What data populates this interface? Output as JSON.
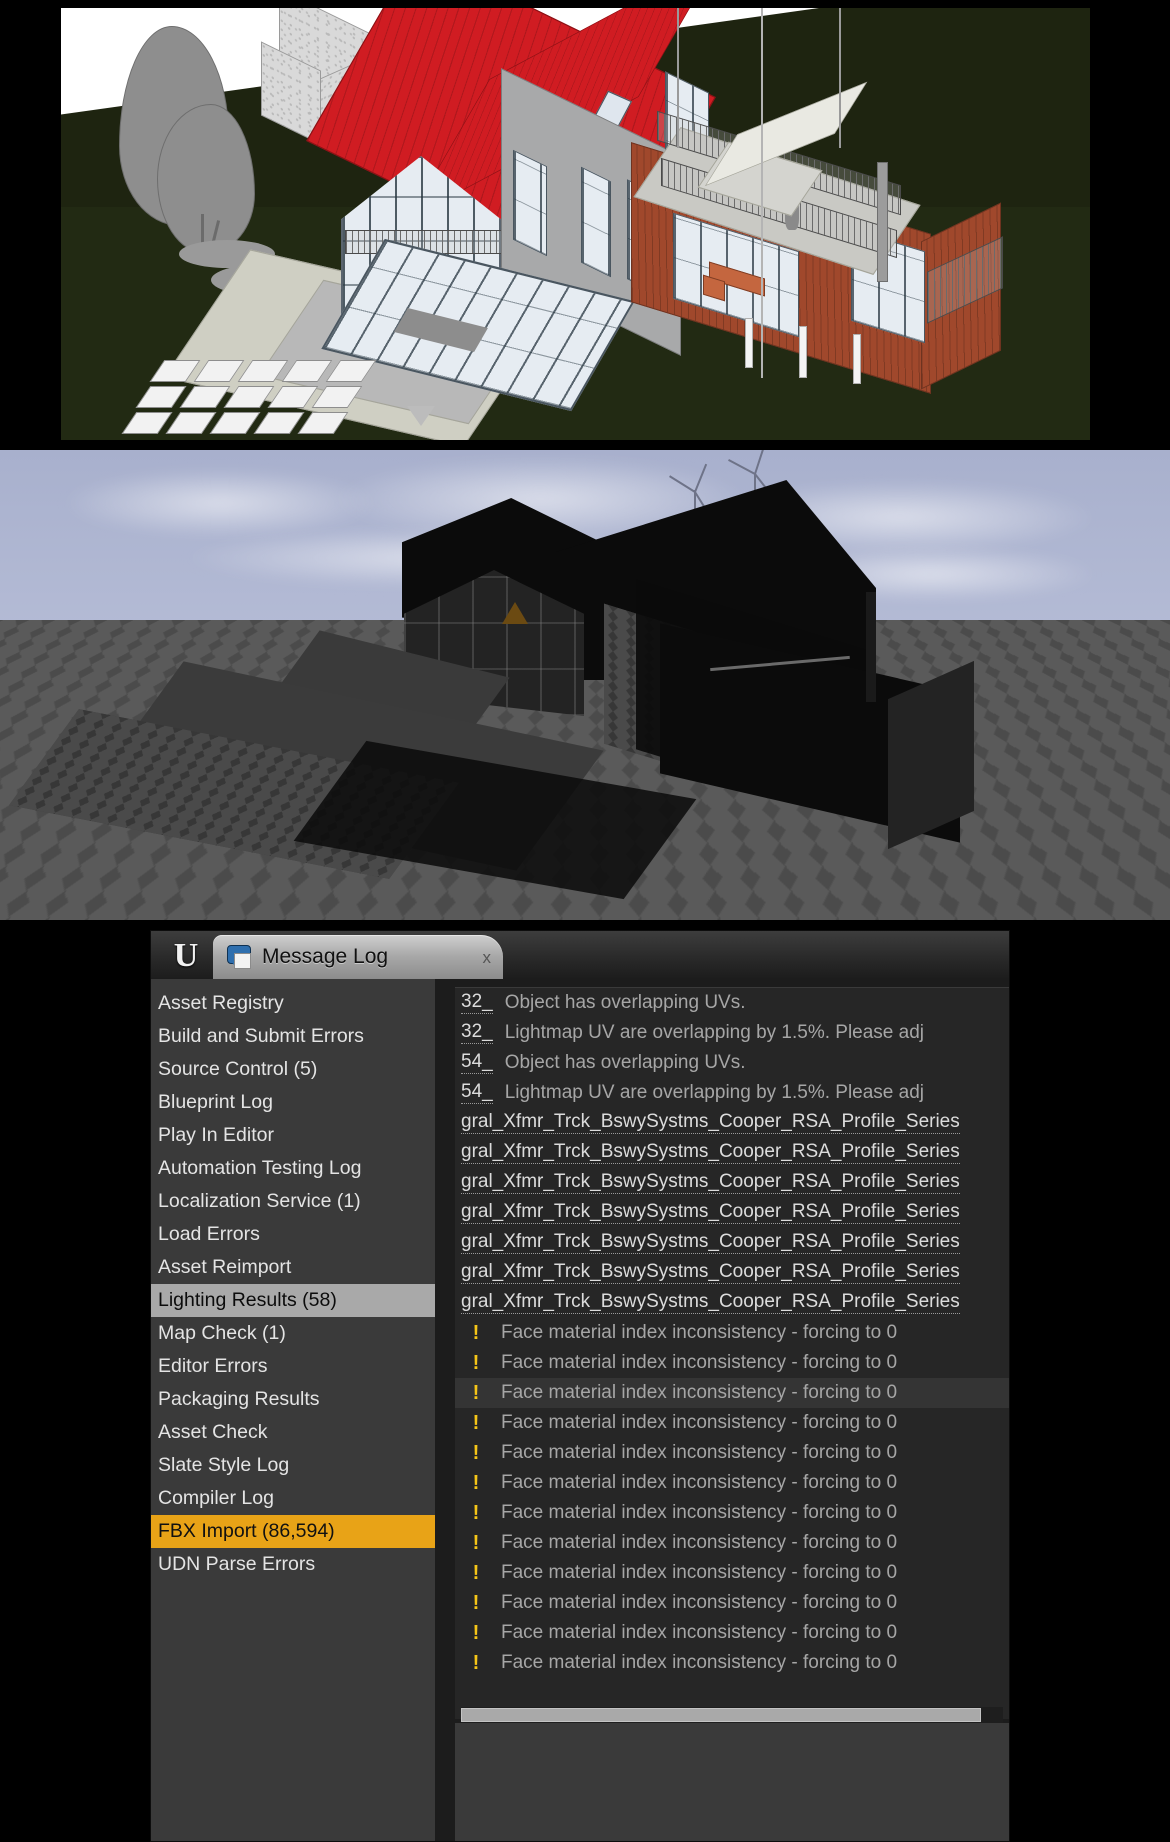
{
  "panels": {
    "cad_view": {
      "name": "architectural-cad-render",
      "description": "Isometric CAD/Revit rendering of a two-storey house with red gabled roof, glass facade, timber-clad wing and landscaped surroundings",
      "colors": {
        "roof": "#d01c22",
        "ground": "#1e2410",
        "wood_cladding": "#a0482c",
        "glass": "#e6ecf2",
        "concrete": "#d9d9d9",
        "sky": "#ffffff"
      }
    },
    "ue_viewport": {
      "name": "unreal-engine-viewport-render",
      "description": "Unreal Engine viewport showing the same building imported as dark unlit geometry on a checkered default-material ground plane with wind turbines on the horizon",
      "colors": {
        "sky_top": "#a8b0cd",
        "sky_bottom": "#d9dce8",
        "ground": "#4a4a4a",
        "geometry": "#0b0b0b"
      }
    }
  },
  "message_log": {
    "window_title": "Message Log",
    "tab": {
      "label": "Message Log",
      "icon": "message-log-icon",
      "close_label": "x"
    },
    "logo_glyph": "U",
    "sidebar": {
      "items": [
        {
          "label": "Asset Registry",
          "state": "normal"
        },
        {
          "label": "Build and Submit Errors",
          "state": "normal"
        },
        {
          "label": "Source Control (5)",
          "state": "normal"
        },
        {
          "label": "Blueprint Log",
          "state": "normal"
        },
        {
          "label": "Play In Editor",
          "state": "normal"
        },
        {
          "label": "Automation Testing Log",
          "state": "normal"
        },
        {
          "label": "Localization Service (1)",
          "state": "normal"
        },
        {
          "label": "Load Errors",
          "state": "normal"
        },
        {
          "label": "Asset Reimport",
          "state": "normal"
        },
        {
          "label": "Lighting Results (58)",
          "state": "selected"
        },
        {
          "label": "Map Check (1)",
          "state": "normal"
        },
        {
          "label": "Editor Errors",
          "state": "normal"
        },
        {
          "label": "Packaging Results",
          "state": "normal"
        },
        {
          "label": "Asset Check",
          "state": "normal"
        },
        {
          "label": "Slate Style Log",
          "state": "normal"
        },
        {
          "label": "Compiler Log",
          "state": "normal"
        },
        {
          "label": "FBX Import (86,594)",
          "state": "active"
        },
        {
          "label": "UDN Parse Errors",
          "state": "normal"
        }
      ]
    },
    "messages": [
      {
        "kind": "link-text",
        "link": "32_",
        "text": "Object has overlapping UVs.",
        "hover": false
      },
      {
        "kind": "link-text",
        "link": "32_",
        "text": "Lightmap UV are overlapping by 1.5%. Please adj",
        "hover": false
      },
      {
        "kind": "link-text",
        "link": "54_",
        "text": "Object has overlapping UVs.",
        "hover": false
      },
      {
        "kind": "link-text",
        "link": "54_",
        "text": "Lightmap UV are overlapping by 1.5%. Please adj",
        "hover": false
      },
      {
        "kind": "link",
        "link": "gral_Xfmr_Trck_BswySystms_Cooper_RSA_Profile_Series",
        "text": "",
        "hover": false
      },
      {
        "kind": "link",
        "link": "gral_Xfmr_Trck_BswySystms_Cooper_RSA_Profile_Series",
        "text": "",
        "hover": false
      },
      {
        "kind": "link",
        "link": "gral_Xfmr_Trck_BswySystms_Cooper_RSA_Profile_Series",
        "text": "",
        "hover": false
      },
      {
        "kind": "link",
        "link": "gral_Xfmr_Trck_BswySystms_Cooper_RSA_Profile_Series",
        "text": "",
        "hover": false
      },
      {
        "kind": "link",
        "link": "gral_Xfmr_Trck_BswySystms_Cooper_RSA_Profile_Series",
        "text": "",
        "hover": false
      },
      {
        "kind": "link",
        "link": "gral_Xfmr_Trck_BswySystms_Cooper_RSA_Profile_Series",
        "text": "",
        "hover": false
      },
      {
        "kind": "link",
        "link": "gral_Xfmr_Trck_BswySystms_Cooper_RSA_Profile_Series",
        "text": "",
        "hover": false
      },
      {
        "kind": "warning",
        "icon": "!",
        "text": "Face material index inconsistency - forcing to 0",
        "hover": false
      },
      {
        "kind": "warning",
        "icon": "!",
        "text": "Face material index inconsistency - forcing to 0",
        "hover": false
      },
      {
        "kind": "warning",
        "icon": "!",
        "text": "Face material index inconsistency - forcing to 0",
        "hover": true
      },
      {
        "kind": "warning",
        "icon": "!",
        "text": "Face material index inconsistency - forcing to 0",
        "hover": false
      },
      {
        "kind": "warning",
        "icon": "!",
        "text": "Face material index inconsistency - forcing to 0",
        "hover": false
      },
      {
        "kind": "warning",
        "icon": "!",
        "text": "Face material index inconsistency - forcing to 0",
        "hover": false
      },
      {
        "kind": "warning",
        "icon": "!",
        "text": "Face material index inconsistency - forcing to 0",
        "hover": false
      },
      {
        "kind": "warning",
        "icon": "!",
        "text": "Face material index inconsistency - forcing to 0",
        "hover": false
      },
      {
        "kind": "warning",
        "icon": "!",
        "text": "Face material index inconsistency - forcing to 0",
        "hover": false
      },
      {
        "kind": "warning",
        "icon": "!",
        "text": "Face material index inconsistency - forcing to 0",
        "hover": false
      },
      {
        "kind": "warning",
        "icon": "!",
        "text": "Face material index inconsistency - forcing to 0",
        "hover": false
      },
      {
        "kind": "warning",
        "icon": "!",
        "text": "Face material index inconsistency - forcing to 0",
        "hover": false
      }
    ],
    "colors": {
      "selected_row": "#a9a9a9",
      "active_row": "#e8a317",
      "warning_icon": "#f5c518",
      "sidebar_bg": "#3a3a3a",
      "list_bg": "#262626",
      "window_bg": "#1c1c1c"
    }
  }
}
